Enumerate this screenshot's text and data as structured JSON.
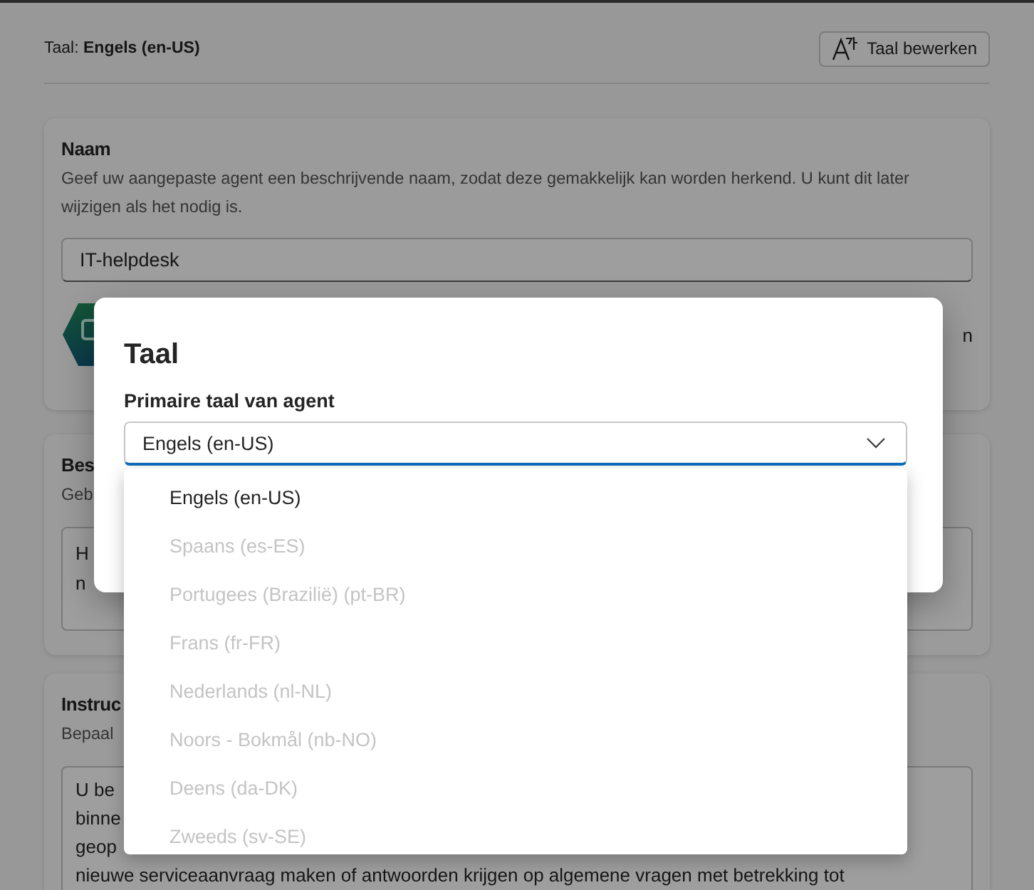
{
  "header": {
    "language": "Taal: **Engels (en-US)**",
    "edit_button": "Taal bewerken"
  },
  "cards": [
    {
      "kind": "input",
      "title": "Naam",
      "description": "Geef uw aangepaste agent een beschrijvende naam, zodat deze gemakkelijk kan worden herkend. U kunt dit later wijzigen als het nodig is.",
      "value": "IT-helpdesk",
      "trailing_text": "n"
    },
    {
      "kind": "textarea",
      "title": "Bes",
      "description": "Geb",
      "lines": [
        "H",
        "n"
      ]
    },
    {
      "kind": "textarea",
      "title": "Instruc",
      "description": "Bepaal",
      "lines": [
        "U be",
        "binne",
        "geop",
        "nieuwe serviceaanvraag maken of antwoorden krijgen op algemene vragen met betrekking tot"
      ]
    }
  ],
  "dialog": {
    "title": "Taal",
    "field_label": "Primaire taal van agent",
    "value": "Engels (en-US)",
    "expanded": true,
    "options": [
      {
        "label": "Engels (en-US)",
        "disabled": false
      },
      {
        "label": "Spaans (es-ES)",
        "disabled": true
      },
      {
        "label": "Portugees (Brazilië) (pt-BR)",
        "disabled": true
      },
      {
        "label": "Frans (fr-FR)",
        "disabled": true
      },
      {
        "label": "Nederlands (nl-NL)",
        "disabled": true
      },
      {
        "label": "Noors - Bokmål (nb-NO)",
        "disabled": true
      },
      {
        "label": "Deens (da-DK)",
        "disabled": true
      },
      {
        "label": "Zweeds (sv-SE)",
        "disabled": true
      }
    ]
  }
}
